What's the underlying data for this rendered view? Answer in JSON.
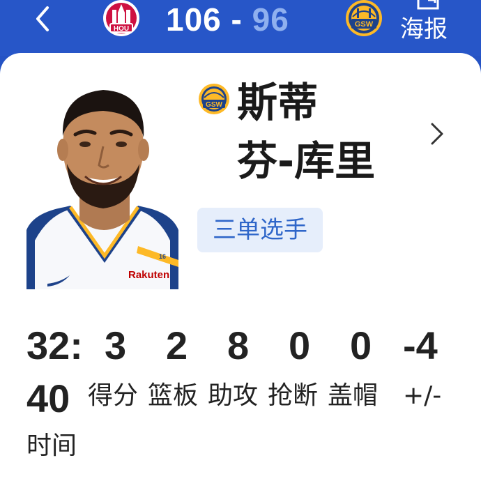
{
  "header": {
    "home_team": "HOU",
    "away_team": "GSW",
    "home_score": "106",
    "separator": "-",
    "away_score": "96",
    "poster_label": "海报",
    "colors": {
      "bar": "#2756c8",
      "home_score": "#ffffff",
      "away_score": "#8fb0ef"
    }
  },
  "player": {
    "team": "GSW",
    "name_line1": "斯蒂",
    "name_line2": "芬-库里",
    "badge": "三单选手",
    "jersey_number": "16",
    "sponsor": "Rakuten"
  },
  "stats": {
    "minutes_value": "32:",
    "minutes_value2": "40",
    "minutes_label": "时间",
    "points": "3",
    "rebounds": "2",
    "assists": "8",
    "steals": "0",
    "blocks": "0",
    "plus_minus": "-4",
    "labels": {
      "points": "得分",
      "rebounds": "篮板",
      "assists": "助攻",
      "steals": "抢断",
      "blocks": "盖帽",
      "plus_minus": "+/-"
    }
  }
}
